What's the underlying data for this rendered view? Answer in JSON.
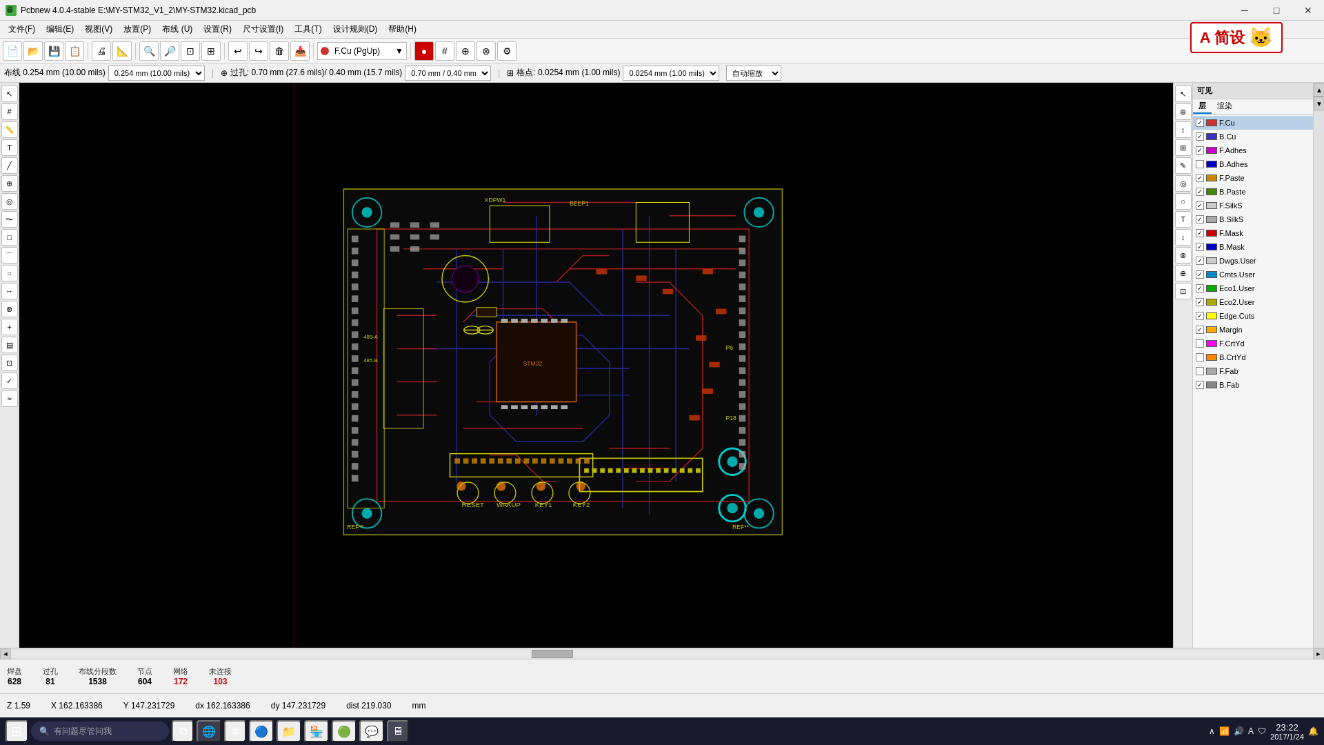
{
  "titlebar": {
    "title": "Pcbnew 4.0.4-stable E:\\MY-STM32_V1_2\\MY-STM32.kicad_pcb",
    "icon": "pcb",
    "minimize": "─",
    "maximize": "□",
    "close": "✕"
  },
  "menubar": {
    "items": [
      {
        "label": "文件(F)"
      },
      {
        "label": "编辑(E)"
      },
      {
        "label": "视图(V)"
      },
      {
        "label": "放置(P)"
      },
      {
        "label": "布线 (U)"
      },
      {
        "label": "设置(R)"
      },
      {
        "label": "尺寸设置(I)"
      },
      {
        "label": "工具(T)"
      },
      {
        "label": "设计规则(D)"
      },
      {
        "label": "帮助(H)"
      }
    ]
  },
  "toolbar": {
    "layer_select": "F.Cu (PgUp)",
    "layer_color": "#cc0000"
  },
  "parambar": {
    "trace_width": "布线 0.254 mm (10.00 mils)",
    "via_size": "过孔: 0.70 mm (27.6 mils)/ 0.40 mm (15.7 mils)",
    "grid": "格点: 0.0254 mm (1.00 mils)",
    "zoom": "自动缩放"
  },
  "layers": {
    "panel_header": "可见",
    "tabs": [
      "层",
      "渲染"
    ],
    "items": [
      {
        "name": "F.Cu",
        "color": "#cc3333",
        "checked": true,
        "active": true
      },
      {
        "name": "B.Cu",
        "color": "#3333cc",
        "checked": true,
        "active": false
      },
      {
        "name": "F.Adhes",
        "color": "#cc00cc",
        "checked": true,
        "active": false
      },
      {
        "name": "B.Adhes",
        "color": "#0000cc",
        "checked": false,
        "active": false
      },
      {
        "name": "F.Paste",
        "color": "#cc8800",
        "checked": true,
        "active": false
      },
      {
        "name": "B.Paste",
        "color": "#448800",
        "checked": true,
        "active": false
      },
      {
        "name": "F.SilkS",
        "color": "#cccccc",
        "checked": true,
        "active": false
      },
      {
        "name": "B.SilkS",
        "color": "#aaaaaa",
        "checked": true,
        "active": false
      },
      {
        "name": "F.Mask",
        "color": "#cc0000",
        "checked": true,
        "active": false
      },
      {
        "name": "B.Mask",
        "color": "#0000cc",
        "checked": true,
        "active": false
      },
      {
        "name": "Dwgs.User",
        "color": "#cccccc",
        "checked": true,
        "active": false
      },
      {
        "name": "Cmts.User",
        "color": "#0088cc",
        "checked": true,
        "active": false
      },
      {
        "name": "Eco1.User",
        "color": "#00aa00",
        "checked": true,
        "active": false
      },
      {
        "name": "Eco2.User",
        "color": "#aaaa00",
        "checked": true,
        "active": false
      },
      {
        "name": "Edge.Cuts",
        "color": "#ffff00",
        "checked": true,
        "active": false
      },
      {
        "name": "Margin",
        "color": "#ffaa00",
        "checked": true,
        "active": false
      },
      {
        "name": "F.CrtYd",
        "color": "#ff00ff",
        "checked": false,
        "active": false
      },
      {
        "name": "B.CrtYd",
        "color": "#ff8800",
        "checked": false,
        "active": false
      },
      {
        "name": "F.Fab",
        "color": "#aaaaaa",
        "checked": false,
        "active": false
      },
      {
        "name": "B.Fab",
        "color": "#888888",
        "checked": true,
        "active": false
      }
    ]
  },
  "stats": {
    "pads_label": "焊盘",
    "pads_value": "628",
    "vias_label": "过孔",
    "vias_value": "81",
    "traces_label": "布线分段数",
    "traces_value": "1538",
    "nodes_label": "节点",
    "nodes_value": "604",
    "nets_label": "网络",
    "nets_value": "172",
    "unconnected_label": "未连接",
    "unconnected_value": "103"
  },
  "statusbar": {
    "z": "Z 1.59",
    "x": "X 162.163386",
    "y": "Y 147.231729",
    "dx": "dx 162.163386",
    "dy": "dy 147.231729",
    "dist": "dist 219.030",
    "unit": "mm"
  },
  "taskbar": {
    "search_placeholder": "有问题尽管问我",
    "time": "23:22",
    "date": "2017/1/24",
    "start_label": "⊞",
    "apps": [
      "🔍",
      "📁",
      "🌐",
      "💻",
      "🎮",
      "🛡️",
      "⭕"
    ]
  }
}
